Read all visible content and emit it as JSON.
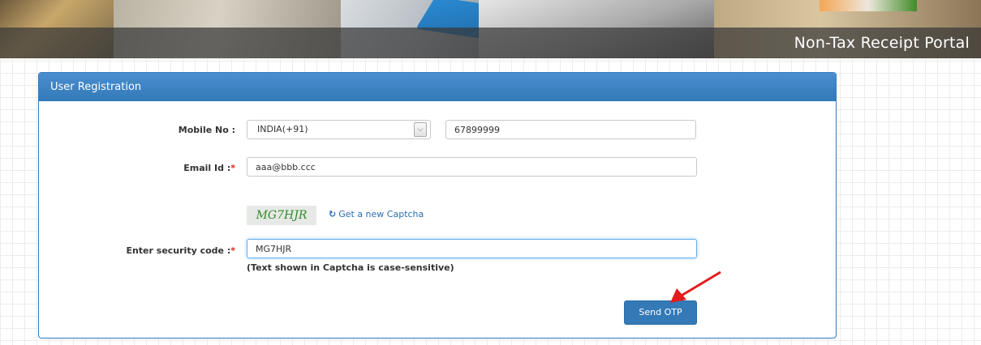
{
  "header": {
    "portal_title": "Non-Tax Receipt Portal"
  },
  "panel": {
    "title": "User Registration"
  },
  "form": {
    "mobile": {
      "label": "Mobile No :",
      "country": "INDIA(+91)",
      "number": "67899999"
    },
    "email": {
      "label": "Email Id :",
      "required_mark": "*",
      "value": "aaa@bbb.ccc"
    },
    "captcha": {
      "code": "MG7HJR",
      "refresh_icon": "↻",
      "refresh_label": "Get a new Captcha"
    },
    "security": {
      "label": "Enter security code :",
      "required_mark": "*",
      "value": "MG7HJR",
      "hint": "(Text shown in Captcha is case-sensitive)"
    },
    "submit_label": "Send OTP"
  },
  "colors": {
    "primary": "#337ab7",
    "required": "#e02020",
    "captcha_text": "#2e8b2e"
  }
}
